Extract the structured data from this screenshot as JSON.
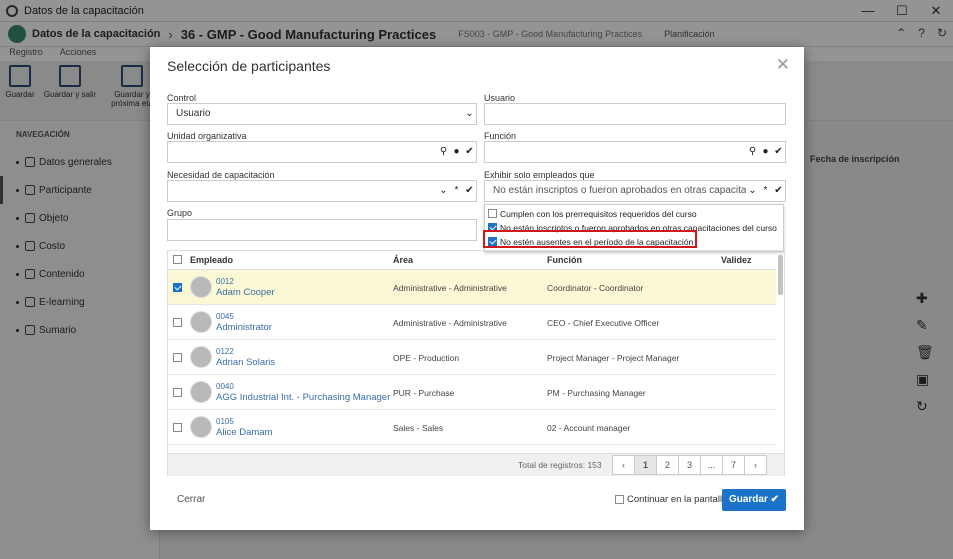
{
  "window": {
    "title": "Datos de la capacitación",
    "min": "—",
    "max": "☐",
    "close": "✕"
  },
  "header": {
    "section": "Datos de la capacitación",
    "record": "36 - GMP - Good Manufacturing Practices",
    "meta": "FS003 - GMP - Good Manufacturing Practices",
    "plan": "Planificación"
  },
  "toolbar": {
    "tabs": [
      "Registro",
      "Acciones"
    ],
    "save": "Guardar",
    "save_exit": "Guardar y salir",
    "save_next": "Guardar y próxima eta"
  },
  "sidebar": {
    "heading": "NAVEGACIÓN",
    "items": [
      {
        "label": "Datos generales"
      },
      {
        "label": "Participante"
      },
      {
        "label": "Objeto"
      },
      {
        "label": "Costo"
      },
      {
        "label": "Contenido"
      },
      {
        "label": "E-learning"
      },
      {
        "label": "Sumario"
      }
    ]
  },
  "background": {
    "fecha_header": "Fecha de inscripción"
  },
  "dialog": {
    "title": "Selección de participantes",
    "close": "✕",
    "control_label": "Control",
    "control_value": "Usuario",
    "usuario_label": "Usuario",
    "unidad_label": "Unidad organizativa",
    "funcion_label": "Función",
    "necesidad_label": "Necesidad de capacitación",
    "exhibir_label": "Exhibir solo empleados que",
    "exhibir_value": "No están inscriptos o fueron aprobados en otras capacita",
    "grupo_label": "Grupo",
    "options": [
      {
        "label": "Cumplen con los prerrequisitos requeridos del curso",
        "checked": false
      },
      {
        "label": "No están inscriptos o fueron aprobados en otras capacitaciones del curso",
        "checked": true
      },
      {
        "label": "No estén ausentes en el período de la capacitación",
        "checked": true
      }
    ],
    "grid": {
      "columns": [
        "Empleado",
        "Área",
        "Función",
        "Validez"
      ],
      "rows": [
        {
          "code": "0012",
          "name": "Adam Cooper",
          "area": "Administrative - Administrative",
          "funcion": "Coordinator - Coordinator",
          "selected": true
        },
        {
          "code": "0045",
          "name": "Administrator",
          "area": "Administrative - Administrative",
          "funcion": "CEO - Chief Executive Officer",
          "selected": false
        },
        {
          "code": "0122",
          "name": "Adrian Solaris",
          "area": "OPE - Production",
          "funcion": "Project Manager - Project Manager",
          "selected": false
        },
        {
          "code": "0040",
          "name": "AGG Industrial Int. - Purchasing Manager",
          "area": "PUR - Purchase",
          "funcion": "PM - Purchasing Manager",
          "selected": false
        },
        {
          "code": "0105",
          "name": "Alice Damam",
          "area": "Sales - Sales",
          "funcion": "02 - Account manager",
          "selected": false
        }
      ],
      "total_label": "Total de registros: 153",
      "pages": [
        "‹",
        "1",
        "2",
        "3",
        "...",
        "7",
        "›"
      ]
    },
    "cancel": "Cerrar",
    "continue_label": "Continuar en la pantalla",
    "save": "Guardar"
  }
}
